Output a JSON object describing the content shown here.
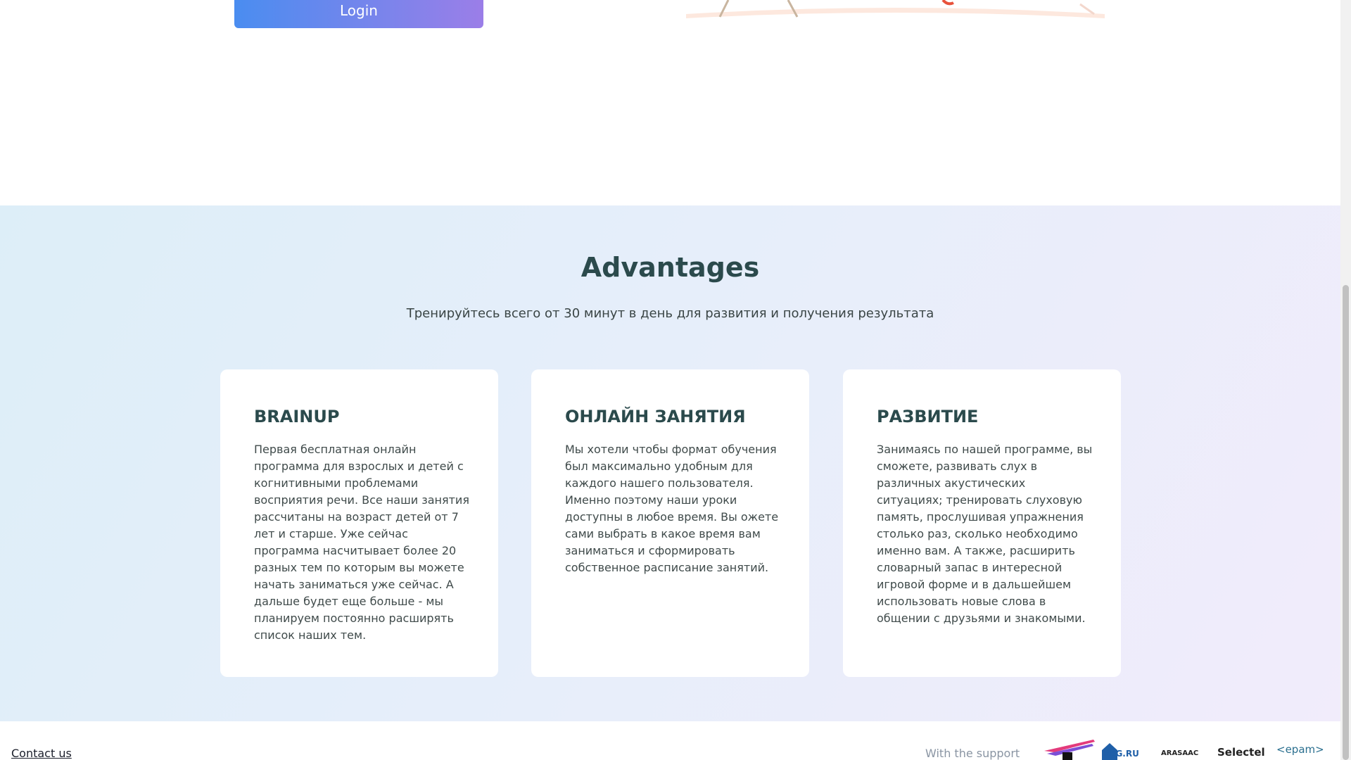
{
  "login": {
    "label": "Login"
  },
  "advantages": {
    "title": "Advantages",
    "subtitle": "Тренируйтесь всего от 30 минут в день для развития и получения результата",
    "cards": [
      {
        "title": "BRAINUP",
        "text": "Первая бесплатная онлайн программа для взрослых и детей с когнитивными проблемами восприятия речи. Все наши занятия рассчитаны на возраст детей от 7 лет и старше. Уже сейчас программа насчитывает более 20 разных тем по которым вы можете начать заниматься уже сейчас. А дальше будет еще больше - мы планируем постоянно расширять список наших тем."
      },
      {
        "title": "ОНЛАЙН ЗАНЯТИЯ",
        "text": "Мы хотели чтобы формат обучения был максимально удобным для каждого нашего пользователя. Именно поэтому наши уроки доступны в любое время. Вы ожете сами выбрать в какое время вам заниматься и сформировать собственное расписание занятий."
      },
      {
        "title": "РАЗВИТИЕ",
        "text": "Занимаясь по нашей программе, вы сможете, развивать слух в различных акустических ситуациях; тренировать слуховую память, прослушивая упражнения столько раз, сколько необходимо именно вам. А также, расширить словарный запас в интересной игровой форме и в дальшейшем использовать новые слова в общении с друзьями и знакомыми."
      }
    ]
  },
  "footer": {
    "contact": "Contact us",
    "support": "With the support",
    "sponsors": [
      "REG.RU",
      "ARASAAC",
      "Selectel",
      "<epam>"
    ]
  },
  "colors": {
    "login_gradient_start": "#4a8df0",
    "login_gradient_end": "#9b7ee8",
    "heading": "#2b4a4c",
    "section_bg": "#e4eef9"
  }
}
